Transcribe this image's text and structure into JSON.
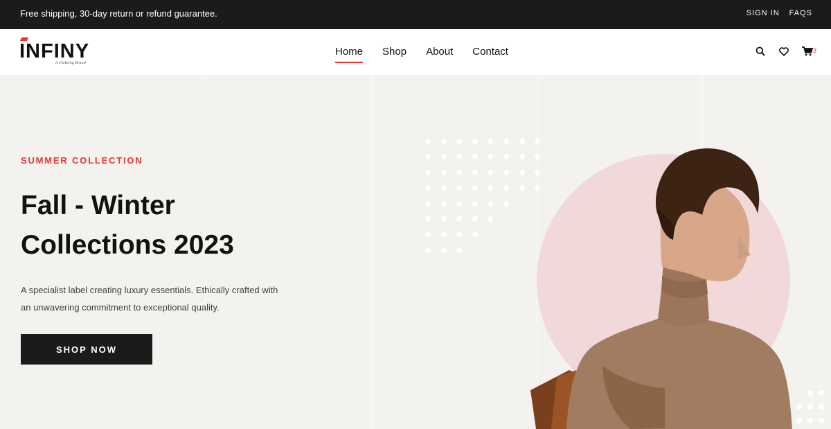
{
  "topbar": {
    "shipping_text": "Free shipping, 30-day return or refund guarantee.",
    "sign_in": "SIGN IN",
    "faqs": "FAQS"
  },
  "header": {
    "logo_text": "INFINY",
    "logo_tagline": "A Clothing Brand",
    "nav": [
      {
        "label": "Home",
        "active": true
      },
      {
        "label": "Shop",
        "active": false
      },
      {
        "label": "About",
        "active": false
      },
      {
        "label": "Contact",
        "active": false
      }
    ],
    "icons": [
      "search-icon",
      "heart-icon",
      "cart-icon"
    ],
    "cart_count": "3"
  },
  "hero": {
    "label": "SUMMER COLLECTION",
    "title_line1": "Fall - Winter",
    "title_line2": "Collections 2023",
    "description_line1": "A specialist label creating luxury essentials. Ethically crafted with",
    "description_line2": "an unwavering commitment to exceptional quality.",
    "cta": "SHOP NOW"
  },
  "colors": {
    "accent": "#e53637",
    "dark": "#1b1b1b",
    "hero_bg": "#f3f2ee",
    "circle": "#f1d9da",
    "sweater": "#a27c61"
  }
}
